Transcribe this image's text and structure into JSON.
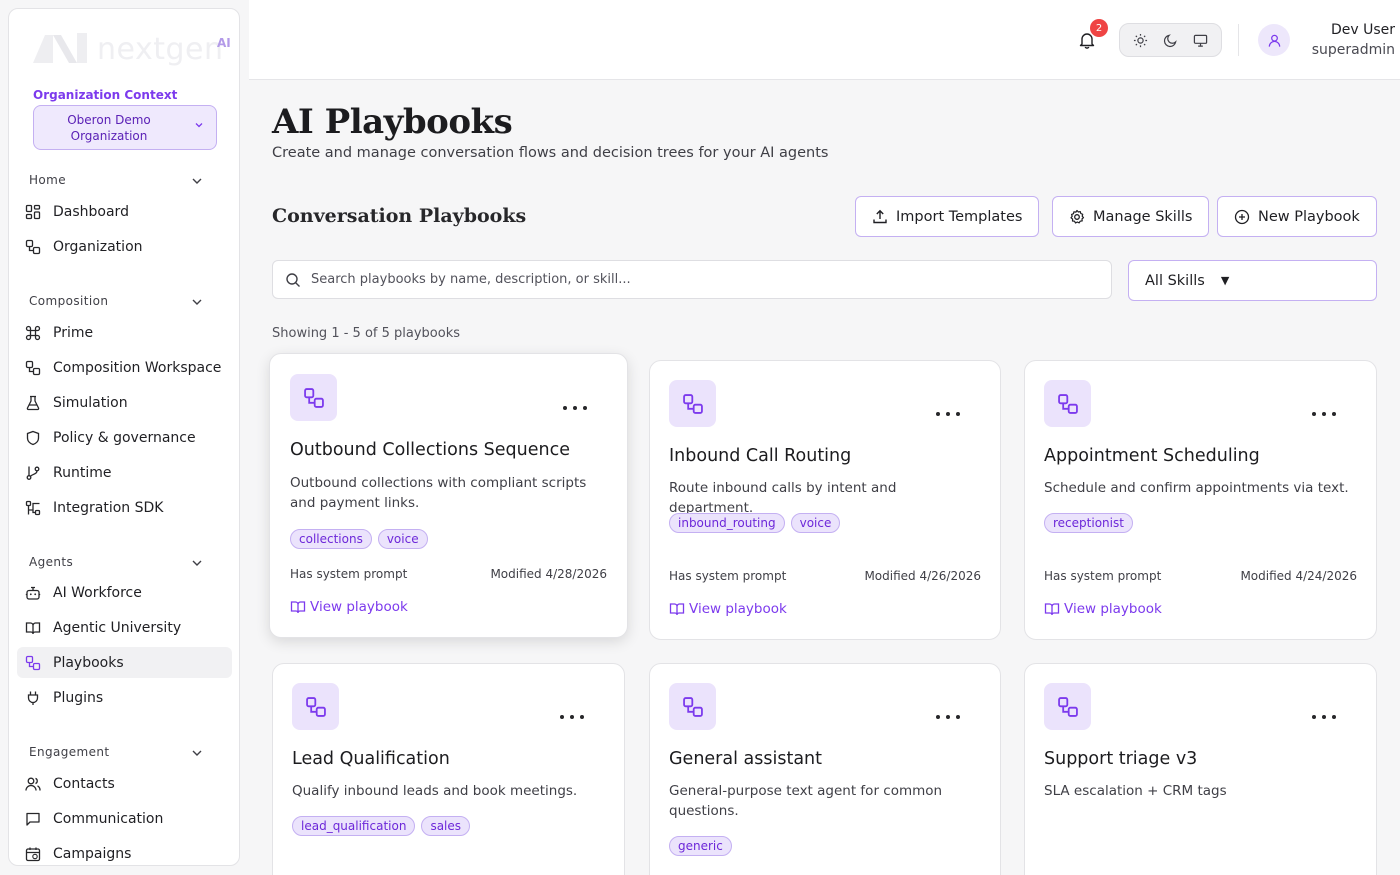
{
  "brand": {
    "name": "nextgen",
    "suffix": "AI"
  },
  "org": {
    "label": "Organization Context",
    "selected": "Oberon Demo Organization"
  },
  "nav": {
    "home": {
      "title": "Home",
      "items": [
        {
          "label": "Dashboard",
          "icon": "dashboard-icon"
        },
        {
          "label": "Organization",
          "icon": "workflow-icon"
        }
      ]
    },
    "composition": {
      "title": "Composition",
      "items": [
        {
          "label": "Prime",
          "icon": "command-icon"
        },
        {
          "label": "Composition Workspace",
          "icon": "workflow-icon"
        },
        {
          "label": "Simulation",
          "icon": "flask-icon"
        },
        {
          "label": "Policy & governance",
          "icon": "shield-icon"
        },
        {
          "label": "Runtime",
          "icon": "git-branch-icon"
        },
        {
          "label": "Integration SDK",
          "icon": "sdk-icon"
        }
      ]
    },
    "agents": {
      "title": "Agents",
      "items": [
        {
          "label": "AI Workforce",
          "icon": "bot-icon"
        },
        {
          "label": "Agentic University",
          "icon": "book-icon"
        },
        {
          "label": "Playbooks",
          "icon": "workflow-icon",
          "active": true
        },
        {
          "label": "Plugins",
          "icon": "plug-icon"
        }
      ]
    },
    "engagement": {
      "title": "Engagement",
      "items": [
        {
          "label": "Contacts",
          "icon": "users-icon"
        },
        {
          "label": "Communication",
          "icon": "message-icon"
        },
        {
          "label": "Campaigns",
          "icon": "calendar-icon"
        }
      ]
    }
  },
  "topbar": {
    "notifications": "2",
    "user_name": "Dev User",
    "user_role": "superadmin"
  },
  "page": {
    "title": "AI Playbooks",
    "subtitle": "Create and manage conversation flows and decision trees for your AI agents",
    "section_title": "Conversation Playbooks",
    "buttons": {
      "import": "Import Templates",
      "skills": "Manage Skills",
      "new": "New Playbook"
    },
    "search_placeholder": "Search playbooks by name, description, or skill...",
    "filter_selected": "All Skills",
    "showing": "Showing 1 - 5 of 5 playbooks"
  },
  "colors": {
    "accent": "#7c3aed",
    "accent_bg": "#ebe3fc",
    "badge": "#ef4444"
  },
  "cards": [
    {
      "title": "Outbound Collections Sequence",
      "description": "Outbound collections with compliant scripts and payment links.",
      "tags": [
        "collections",
        "voice"
      ],
      "prompt": "Has system prompt",
      "modified": "Modified 4/28/2026",
      "link": "View playbook"
    },
    {
      "title": "Inbound Call Routing",
      "description": "Route inbound calls by intent and department.",
      "tags": [
        "inbound_routing",
        "voice"
      ],
      "prompt": "Has system prompt",
      "modified": "Modified 4/26/2026",
      "link": "View playbook"
    },
    {
      "title": "Appointment Scheduling",
      "description": "Schedule and confirm appointments via text.",
      "tags": [
        "receptionist"
      ],
      "prompt": "Has system prompt",
      "modified": "Modified 4/24/2026",
      "link": "View playbook"
    },
    {
      "title": "Lead Qualification",
      "description": "Qualify inbound leads and book meetings.",
      "tags": [
        "lead_qualification",
        "sales"
      ]
    },
    {
      "title": "General assistant",
      "description": "General-purpose text agent for common questions.",
      "tags": [
        "generic"
      ]
    },
    {
      "title": "Support triage v3",
      "description": "SLA escalation + CRM tags",
      "tags": []
    }
  ]
}
